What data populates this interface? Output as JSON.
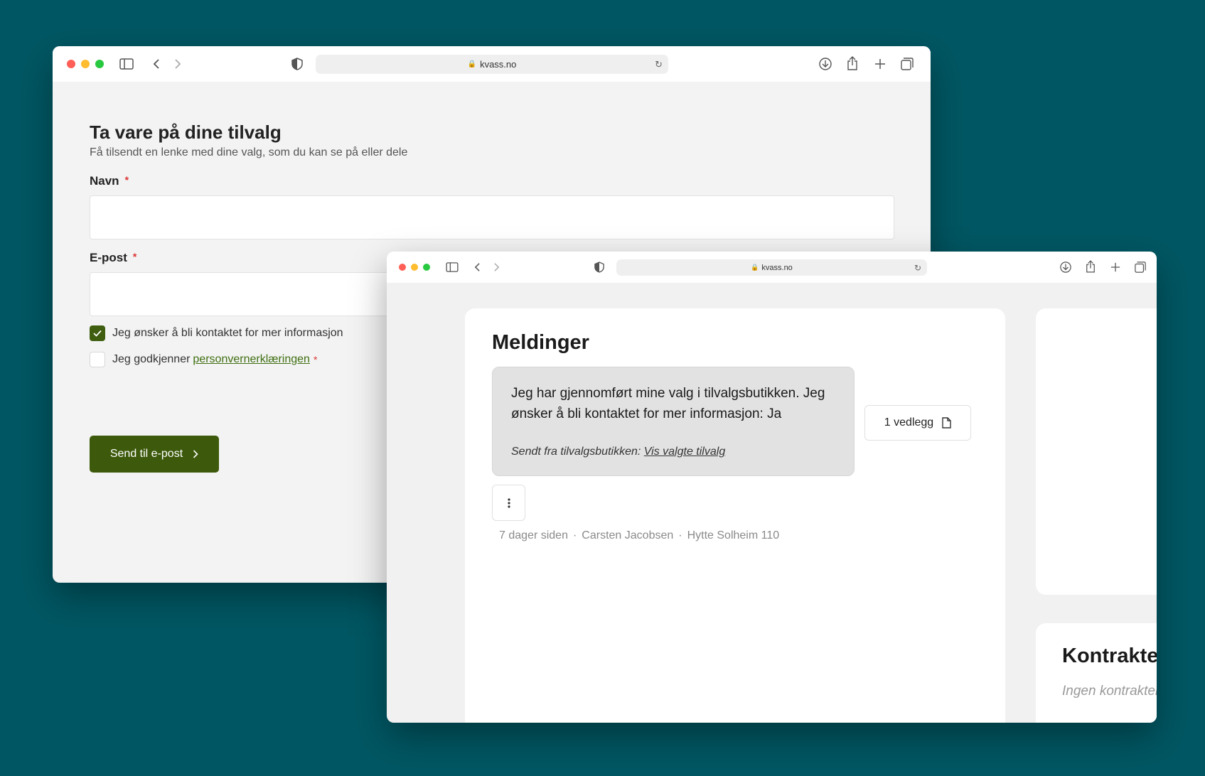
{
  "back_window": {
    "url": "kvass.no",
    "form": {
      "title": "Ta vare på dine tilvalg",
      "subtitle": "Få tilsendt en lenke med dine valg, som du kan se på eller dele",
      "name_label": "Navn",
      "email_label": "E-post",
      "required_mark": "*",
      "contact_checkbox": {
        "label": "Jeg ønsker å bli kontaktet for mer informasjon",
        "checked": true
      },
      "privacy_checkbox": {
        "label": "Jeg godkjenner",
        "link": "personvernerklæringen",
        "checked": false
      },
      "submit_label": "Send til e-post"
    }
  },
  "front_window": {
    "url": "kvass.no",
    "messages": {
      "title": "Meldinger",
      "message_text": "Jeg har gjennomført mine valg i tilvalgsbutikken. Jeg ønsker å bli kontaktet for mer informasjon: Ja",
      "footer_prefix": "Sendt fra tilvalgsbutikken:",
      "footer_link": "Vis valgte tilvalg",
      "attachment_label": "1 vedlegg",
      "meta": {
        "time": "7 dager siden",
        "author": "Carsten Jacobsen",
        "unit": "Hytte Solheim 110",
        "separator": "·"
      }
    },
    "contracts": {
      "title": "Kontrakter",
      "empty_text": "Ingen kontrakter"
    }
  },
  "colors": {
    "background": "#005763",
    "accent": "#3d5a0c",
    "close": "#ff5f57",
    "minimize": "#febc2e",
    "zoom": "#28c840"
  }
}
